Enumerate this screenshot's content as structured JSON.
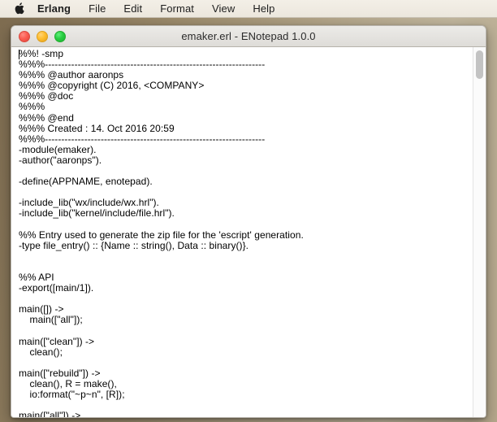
{
  "menubar": {
    "apple_icon": "apple-logo-icon",
    "items": [
      {
        "label": "Erlang",
        "bold": true
      },
      {
        "label": "File",
        "bold": false
      },
      {
        "label": "Edit",
        "bold": false
      },
      {
        "label": "Format",
        "bold": false
      },
      {
        "label": "View",
        "bold": false
      },
      {
        "label": "Help",
        "bold": false
      }
    ]
  },
  "window": {
    "title": "emaker.erl - ENotepad 1.0.0",
    "controls": {
      "close": "close-button",
      "minimize": "minimize-button",
      "zoom": "zoom-button"
    }
  },
  "editor": {
    "filename": "emaker.erl",
    "language": "erlang",
    "content": "%%! -smp\n%%%-------------------------------------------------------------------\n%%% @author aaronps\n%%% @copyright (C) 2016, <COMPANY>\n%%% @doc\n%%%\n%%% @end\n%%% Created : 14. Oct 2016 20:59\n%%%-------------------------------------------------------------------\n-module(emaker).\n-author(\"aaronps\").\n\n-define(APPNAME, enotepad).\n\n-include_lib(\"wx/include/wx.hrl\").\n-include_lib(\"kernel/include/file.hrl\").\n\n%% Entry used to generate the zip file for the 'escript' generation.\n-type file_entry() :: {Name :: string(), Data :: binary()}.\n\n\n%% API\n-export([main/1]).\n\nmain([]) ->\n    main([\"all\"]);\n\nmain([\"clean\"]) ->\n    clean();\n\nmain([\"rebuild\"]) ->\n    clean(), R = make(),\n    io:format(\"~p~n\", [R]);\n\nmain([\"all\"]) ->"
  },
  "scrollbar": {
    "name": "vertical-scrollbar",
    "thumb": "scrollbar-thumb"
  },
  "colors": {
    "desktop": "#9b8a6b",
    "titlebar": "#e4e2de",
    "editor_bg": "#ffffff",
    "text": "#000000",
    "close": "#fb5d52",
    "minimize": "#ffbd2e",
    "zoom": "#28cd41"
  }
}
